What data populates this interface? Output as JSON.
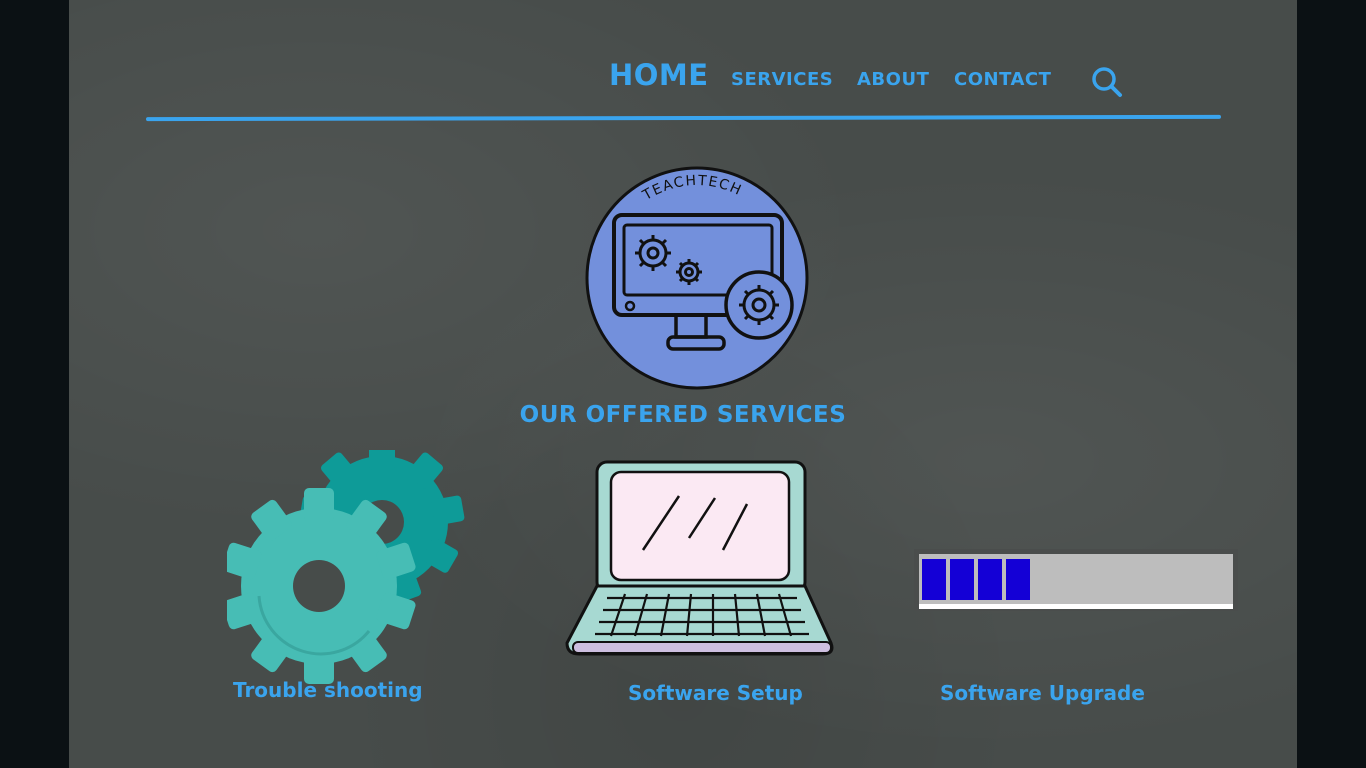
{
  "nav": {
    "items": [
      {
        "label": "HOME"
      },
      {
        "label": "SERVICES"
      },
      {
        "label": "ABOUT"
      },
      {
        "label": "CONTACT"
      }
    ],
    "search_icon": "search-icon",
    "accent_color": "#3aa4ee"
  },
  "logo": {
    "text": "TEACHTECH",
    "icon": "monitor-gears-icon",
    "fill_color": "#7390dc"
  },
  "services": {
    "title": "OUR OFFERED SERVICES",
    "items": [
      {
        "label": "Trouble shooting",
        "icon": "gears-icon",
        "color": "#47bdb5"
      },
      {
        "label": "Software Setup",
        "icon": "laptop-icon",
        "color": "#a7d9d2"
      },
      {
        "label": "Software Upgrade",
        "icon": "progress-bar-icon",
        "progress_blocks_filled": 4,
        "color": "#1400d6"
      }
    ]
  }
}
